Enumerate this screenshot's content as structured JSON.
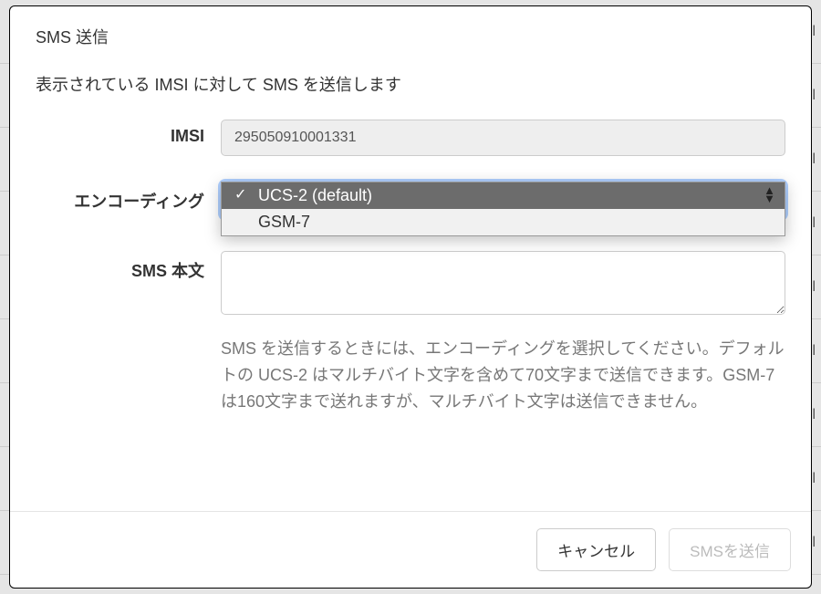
{
  "bg_text": "pl",
  "modal_title": "SMS 送信",
  "description": "表示されている IMSI に対して SMS を送信します",
  "form": {
    "imsi": {
      "label": "IMSI",
      "value": "295050910001331"
    },
    "encoding": {
      "label": "エンコーディング",
      "options": [
        "UCS-2 (default)",
        "GSM-7"
      ],
      "selected": "UCS-2 (default)"
    },
    "body": {
      "label": "SMS 本文",
      "value": ""
    }
  },
  "help": "SMS を送信するときには、エンコーディングを選択してください。デフォルトの UCS-2 はマルチバイト文字を含めて70文字まで送信できます。GSM-7 は160文字まで送れますが、マルチバイト文字は送信できません。",
  "buttons": {
    "cancel": "キャンセル",
    "send": "SMSを送信"
  }
}
